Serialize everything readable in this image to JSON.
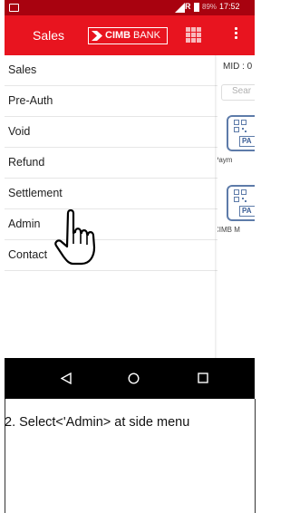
{
  "status_bar": {
    "network": "R",
    "battery": "89%",
    "time": "17:52"
  },
  "app_bar": {
    "title": "Sales",
    "logo": {
      "bold": "CIMB",
      "regular": "BANK"
    }
  },
  "side_menu": {
    "items": [
      {
        "label": "Sales"
      },
      {
        "label": "Pre-Auth"
      },
      {
        "label": "Void"
      },
      {
        "label": "Refund"
      },
      {
        "label": "Settlement"
      },
      {
        "label": "Admin"
      },
      {
        "label": "Contact"
      }
    ]
  },
  "main": {
    "mid_label": "MID : 0",
    "search_placeholder": "Sear",
    "tiles": [
      {
        "label": "Paym",
        "badge": "PA"
      },
      {
        "label": "CIMB M",
        "badge": "PA"
      }
    ]
  },
  "caption": "2. Select<'Admin> at side menu",
  "colors": {
    "status_bar": "#a8020f",
    "app_bar": "#e8141f",
    "tile_border": "#5d7ba9"
  }
}
